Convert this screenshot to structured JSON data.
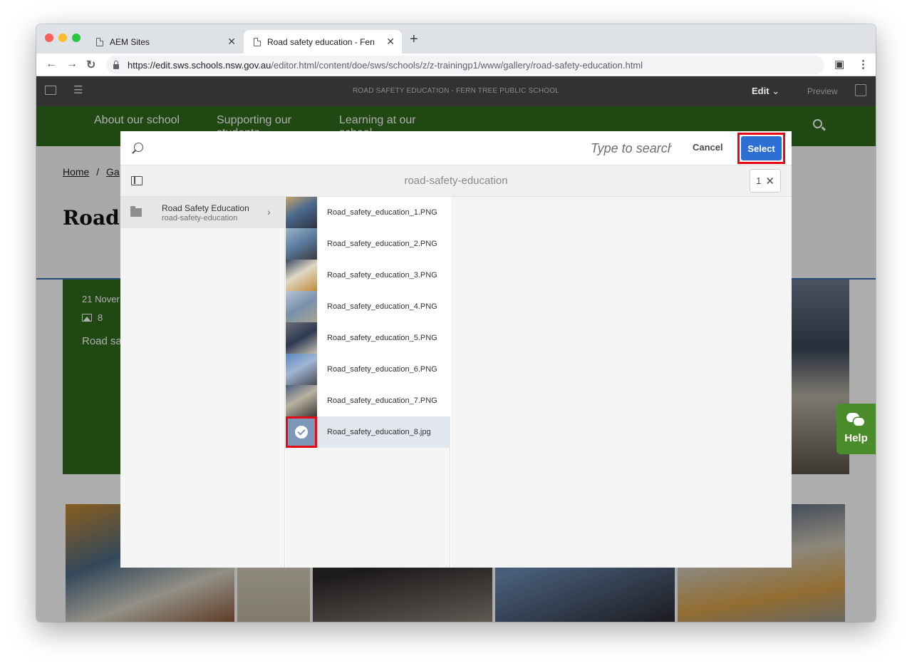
{
  "browser": {
    "tabs": [
      {
        "title": "AEM Sites",
        "active": false
      },
      {
        "title": "Road safety education - Fern T",
        "active": true
      }
    ],
    "url_host": "https://edit.sws.schools.nsw.gov.au",
    "url_path": "/editor.html/content/doe/sws/schools/z/z-trainingp1/www/gallery/road-safety-education.html"
  },
  "aem": {
    "title": "ROAD SAFETY EDUCATION - FERN TREE PUBLIC SCHOOL",
    "mode_label": "Edit",
    "preview_label": "Preview"
  },
  "site": {
    "nav": [
      {
        "line1": "About our school",
        "line2": ""
      },
      {
        "line1": "Supporting our",
        "line2": "students"
      },
      {
        "line1": "Learning at our",
        "line2": "school"
      }
    ],
    "breadcrumb_home": "Home",
    "breadcrumb_sep": "/",
    "breadcrumb_next": "Ga",
    "title": "Road",
    "card_date": "21 Nover",
    "card_count": "8",
    "card_text": "Road sa",
    "help_label": "Help"
  },
  "picker": {
    "search_placeholder": "Type to search",
    "cancel_label": "Cancel",
    "select_label": "Select",
    "folder_title": "road-safety-education",
    "selected_count": "1",
    "folder": {
      "name": "Road Safety Education",
      "path": "road-safety-education"
    },
    "assets": [
      {
        "name": "Road_safety_education_1.PNG",
        "selected": false
      },
      {
        "name": "Road_safety_education_2.PNG",
        "selected": false
      },
      {
        "name": "Road_safety_education_3.PNG",
        "selected": false
      },
      {
        "name": "Road_safety_education_4.PNG",
        "selected": false
      },
      {
        "name": "Road_safety_education_5.PNG",
        "selected": false
      },
      {
        "name": "Road_safety_education_6.PNG",
        "selected": false
      },
      {
        "name": "Road_safety_education_7.PNG",
        "selected": false
      },
      {
        "name": "Road_safety_education_8.jpg",
        "selected": true
      }
    ]
  },
  "colors": {
    "site_green": "#2f6a1d",
    "select_blue": "#2d6fd2",
    "highlight_red": "#e50914",
    "aem_bar": "#323232"
  }
}
